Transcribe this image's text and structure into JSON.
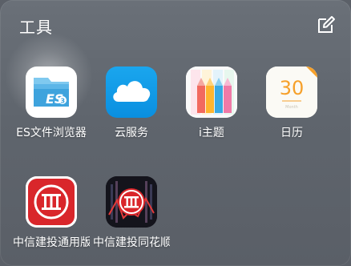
{
  "folder": {
    "title": "工具",
    "edit_icon": "edit-icon"
  },
  "apps": [
    {
      "label": "ES文件浏览器",
      "icon": "es-file-explorer-icon"
    },
    {
      "label": "云服务",
      "icon": "cloud-service-icon"
    },
    {
      "label": "i主题",
      "icon": "itheme-icon"
    },
    {
      "label": "日历",
      "icon": "calendar-icon",
      "date": "30",
      "month": "Month"
    },
    {
      "label": "中信建投通用版",
      "icon": "citic-securities-icon"
    },
    {
      "label": "中信建投同花顺",
      "icon": "citic-tonghuashun-icon"
    }
  ],
  "colors": {
    "cloud_blue": "#1aa6ee",
    "calendar_orange": "#f6a02a",
    "citic_red": "#d9262b"
  }
}
